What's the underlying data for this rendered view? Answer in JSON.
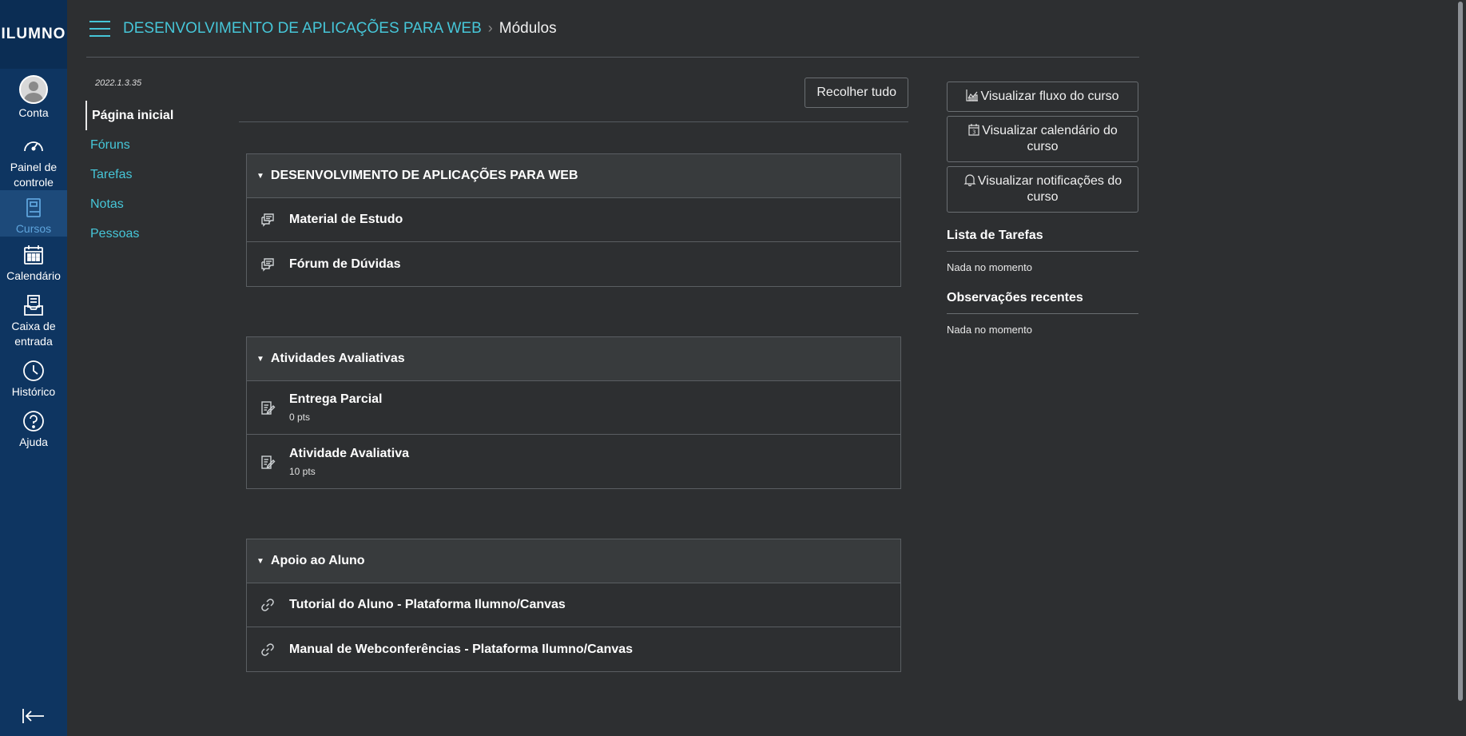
{
  "global_nav": {
    "logo": "ILUMNO",
    "items": [
      {
        "label": "Conta"
      },
      {
        "label": "Painel de controle"
      },
      {
        "label": "Cursos"
      },
      {
        "label": "Calendário"
      },
      {
        "label": "Caixa de entrada"
      },
      {
        "label": "Histórico"
      },
      {
        "label": "Ajuda"
      }
    ]
  },
  "header": {
    "course_title": "DESENVOLVIMENTO DE APLICAÇÕES PARA WEB",
    "separator": "›",
    "current_page": "Módulos"
  },
  "course_nav": {
    "version": "2022.1.3.35",
    "items": [
      {
        "label": "Página inicial"
      },
      {
        "label": "Fóruns"
      },
      {
        "label": "Tarefas"
      },
      {
        "label": "Notas"
      },
      {
        "label": "Pessoas"
      }
    ]
  },
  "toolbar": {
    "collapse_all": "Recolher tudo"
  },
  "modules": [
    {
      "title": "DESENVOLVIMENTO DE APLICAÇÕES PARA WEB",
      "items": [
        {
          "name": "Material de Estudo",
          "icon": "discussion-icon"
        },
        {
          "name": "Fórum de Dúvidas",
          "icon": "discussion-icon"
        }
      ]
    },
    {
      "title": "Atividades Avaliativas",
      "items": [
        {
          "name": "Entrega Parcial",
          "points": "0 pts",
          "icon": "assignment-icon"
        },
        {
          "name": "Atividade Avaliativa",
          "points": "10 pts",
          "icon": "assignment-icon"
        }
      ]
    },
    {
      "title": "Apoio ao Aluno",
      "items": [
        {
          "name": "Tutorial do Aluno - Plataforma Ilumno/Canvas",
          "icon": "link-icon"
        },
        {
          "name": "Manual de Webconferências - Plataforma Ilumno/Canvas",
          "icon": "link-icon"
        }
      ]
    }
  ],
  "right_sidebar": {
    "buttons": [
      {
        "label": "Visualizar fluxo do curso",
        "icon": "chart-icon"
      },
      {
        "label": "Visualizar calendário do curso",
        "icon": "calendar-icon"
      },
      {
        "label": "Visualizar notificações do curso",
        "icon": "bell-icon"
      }
    ],
    "todo_title": "Lista de Tarefas",
    "todo_empty": "Nada no momento",
    "feedback_title": "Observações recentes",
    "feedback_empty": "Nada no momento"
  },
  "colors": {
    "nav_bg": "#0e3561",
    "accent": "#46c6d8",
    "page_bg": "#2d2f31"
  }
}
